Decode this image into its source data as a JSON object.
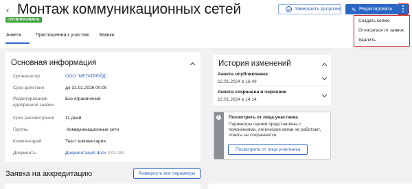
{
  "header": {
    "title": "Монтаж коммуникационных сетей",
    "status": "ОПУБЛИКОВАНА",
    "finish_label": "Завершить досрочно",
    "edit_label": "Редактировать"
  },
  "menu": {
    "items": [
      "Создать копию",
      "Отписаться от заявок",
      "Удалить"
    ]
  },
  "tabs": [
    "Анкета",
    "Приглашения к участию",
    "Заявки"
  ],
  "info_card": {
    "title": "Основная информация",
    "rows": [
      {
        "label": "Организатор",
        "value": "ООО \"МЕГАТРЕЙД\""
      },
      {
        "label": "Срок действия",
        "value": "до 31.01.2026 00:00"
      },
      {
        "label": "Редактирование одобренной заявки",
        "value": "Без ограничений"
      },
      {
        "label": "Срок рассмотрения",
        "value": "11 дней"
      },
      {
        "label": "Группы",
        "value": "Коммуникационные сети"
      },
      {
        "label": "Комментарий",
        "value": "Текст комментария"
      },
      {
        "label": "Документы",
        "value": "Документация docx",
        "meta": "0.01 mb"
      }
    ]
  },
  "history": {
    "title": "История изменений",
    "entries": [
      {
        "title": "Анкета опубликована",
        "date": "12.01.2024 в 16:49"
      },
      {
        "title": "Анкета сохранена в черновик",
        "date": "12.01.2024 в 14:14"
      }
    ]
  },
  "participant_view": {
    "title": "Посмотреть от лица участника",
    "text": "Параметры оценки представлены с пояснениями, логические связи не работают, ответы не сохраняются.",
    "button": "Посмотреть от лица участника"
  },
  "accreditation": {
    "title": "Заявка на аккредитацию",
    "expand_label": "Развернуть все параметры"
  },
  "colors": {
    "accent": "#2c66c4",
    "status_green": "#3aa33a",
    "highlight_red": "#d32a2a"
  }
}
